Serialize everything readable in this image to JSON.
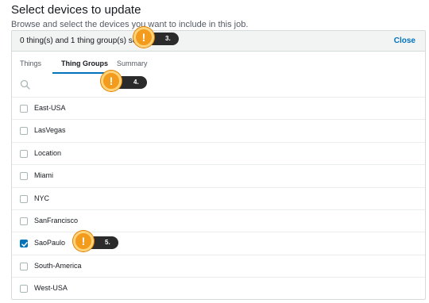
{
  "header": {
    "title": "Select devices to update",
    "subtitle": "Browse and select the devices you want to include in this job."
  },
  "selection": {
    "summary": "0 thing(s) and 1 thing group(s) selecte",
    "close_label": "Close"
  },
  "tabs": [
    {
      "label": "Things",
      "active": false
    },
    {
      "label": "Thing Groups",
      "active": true
    },
    {
      "label": "Summary",
      "active": false
    }
  ],
  "search": {
    "placeholder": ""
  },
  "groups": [
    {
      "label": "East-USA",
      "checked": false
    },
    {
      "label": "LasVegas",
      "checked": false
    },
    {
      "label": "Location",
      "checked": false
    },
    {
      "label": "Miami",
      "checked": false
    },
    {
      "label": "NYC",
      "checked": false
    },
    {
      "label": "SanFrancisco",
      "checked": false
    },
    {
      "label": "SaoPaulo",
      "checked": true
    },
    {
      "label": "South-America",
      "checked": false
    },
    {
      "label": "West-USA",
      "checked": false
    }
  ],
  "callouts": [
    {
      "label": "3.",
      "symbol": "!"
    },
    {
      "label": "4.",
      "symbol": "!"
    },
    {
      "label": "5.",
      "symbol": "!"
    }
  ],
  "colors": {
    "accent": "#0073bb",
    "callout_orange": "#f29b1d",
    "callout_dark": "#2b2b2b"
  }
}
